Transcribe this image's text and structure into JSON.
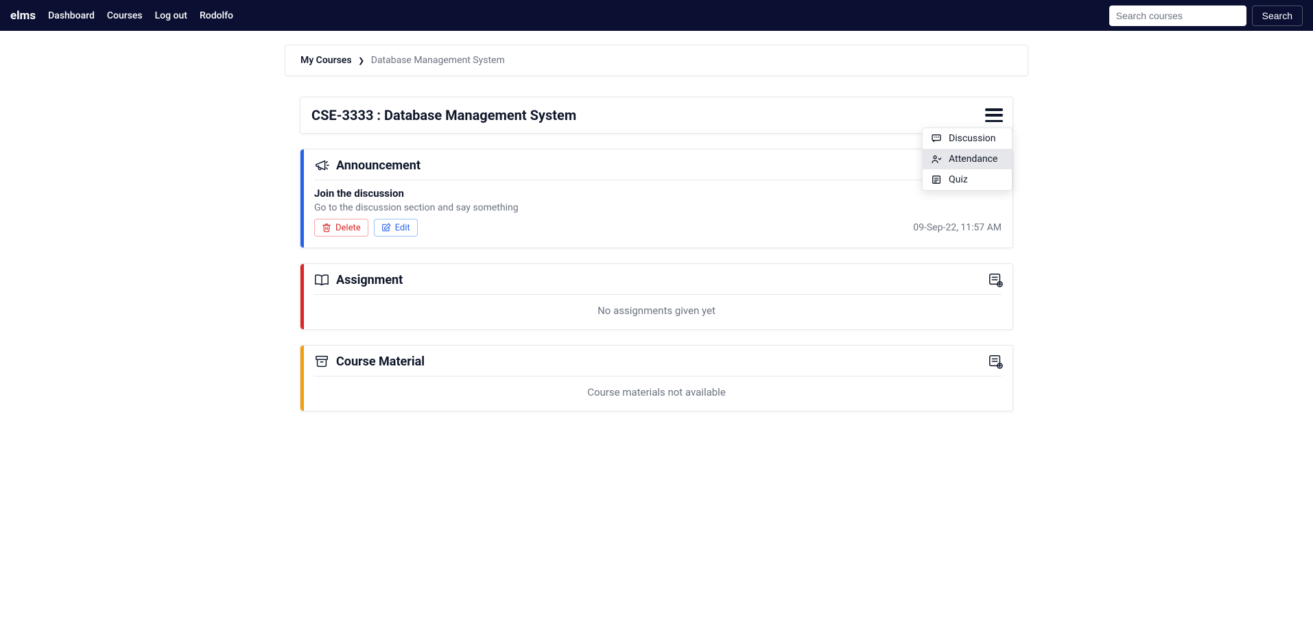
{
  "nav": {
    "brand": "elms",
    "links": [
      "Dashboard",
      "Courses",
      "Log out",
      "Rodolfo"
    ],
    "search_placeholder": "Search courses",
    "search_button": "Search"
  },
  "breadcrumb": {
    "root": "My Courses",
    "current": "Database Management System"
  },
  "course": {
    "title": "CSE-3333 : Database Management System"
  },
  "menu": {
    "items": [
      {
        "label": "Discussion"
      },
      {
        "label": "Attendance"
      },
      {
        "label": "Quiz"
      }
    ]
  },
  "sections": {
    "announcement": {
      "heading": "Announcement",
      "item": {
        "title": "Join the discussion",
        "desc": "Go to the discussion section and say something",
        "timestamp": "09-Sep-22, 11:57 AM"
      },
      "delete_label": "Delete",
      "edit_label": "Edit"
    },
    "assignment": {
      "heading": "Assignment",
      "empty": "No assignments given yet"
    },
    "material": {
      "heading": "Course Material",
      "empty": "Course materials not available"
    }
  }
}
